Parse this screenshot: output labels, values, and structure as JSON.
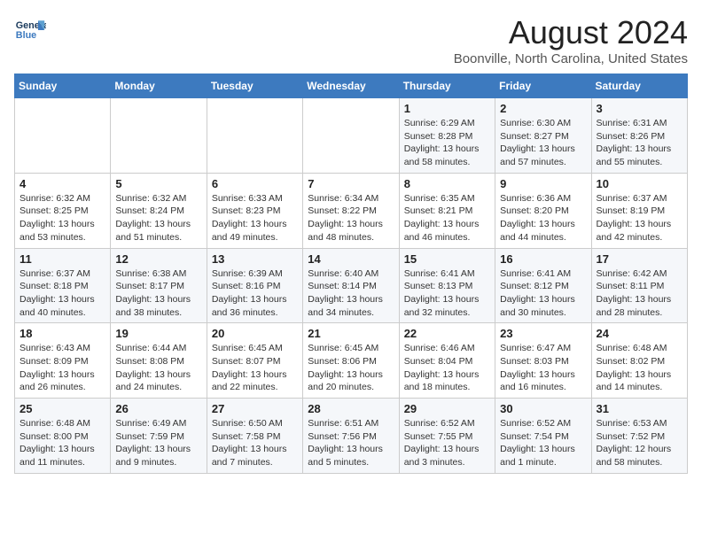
{
  "logo": {
    "line1": "General",
    "line2": "Blue"
  },
  "title": "August 2024",
  "subtitle": "Boonville, North Carolina, United States",
  "days_of_week": [
    "Sunday",
    "Monday",
    "Tuesday",
    "Wednesday",
    "Thursday",
    "Friday",
    "Saturday"
  ],
  "weeks": [
    [
      {
        "day": "",
        "info": ""
      },
      {
        "day": "",
        "info": ""
      },
      {
        "day": "",
        "info": ""
      },
      {
        "day": "",
        "info": ""
      },
      {
        "day": "1",
        "info": "Sunrise: 6:29 AM\nSunset: 8:28 PM\nDaylight: 13 hours\nand 58 minutes."
      },
      {
        "day": "2",
        "info": "Sunrise: 6:30 AM\nSunset: 8:27 PM\nDaylight: 13 hours\nand 57 minutes."
      },
      {
        "day": "3",
        "info": "Sunrise: 6:31 AM\nSunset: 8:26 PM\nDaylight: 13 hours\nand 55 minutes."
      }
    ],
    [
      {
        "day": "4",
        "info": "Sunrise: 6:32 AM\nSunset: 8:25 PM\nDaylight: 13 hours\nand 53 minutes."
      },
      {
        "day": "5",
        "info": "Sunrise: 6:32 AM\nSunset: 8:24 PM\nDaylight: 13 hours\nand 51 minutes."
      },
      {
        "day": "6",
        "info": "Sunrise: 6:33 AM\nSunset: 8:23 PM\nDaylight: 13 hours\nand 49 minutes."
      },
      {
        "day": "7",
        "info": "Sunrise: 6:34 AM\nSunset: 8:22 PM\nDaylight: 13 hours\nand 48 minutes."
      },
      {
        "day": "8",
        "info": "Sunrise: 6:35 AM\nSunset: 8:21 PM\nDaylight: 13 hours\nand 46 minutes."
      },
      {
        "day": "9",
        "info": "Sunrise: 6:36 AM\nSunset: 8:20 PM\nDaylight: 13 hours\nand 44 minutes."
      },
      {
        "day": "10",
        "info": "Sunrise: 6:37 AM\nSunset: 8:19 PM\nDaylight: 13 hours\nand 42 minutes."
      }
    ],
    [
      {
        "day": "11",
        "info": "Sunrise: 6:37 AM\nSunset: 8:18 PM\nDaylight: 13 hours\nand 40 minutes."
      },
      {
        "day": "12",
        "info": "Sunrise: 6:38 AM\nSunset: 8:17 PM\nDaylight: 13 hours\nand 38 minutes."
      },
      {
        "day": "13",
        "info": "Sunrise: 6:39 AM\nSunset: 8:16 PM\nDaylight: 13 hours\nand 36 minutes."
      },
      {
        "day": "14",
        "info": "Sunrise: 6:40 AM\nSunset: 8:14 PM\nDaylight: 13 hours\nand 34 minutes."
      },
      {
        "day": "15",
        "info": "Sunrise: 6:41 AM\nSunset: 8:13 PM\nDaylight: 13 hours\nand 32 minutes."
      },
      {
        "day": "16",
        "info": "Sunrise: 6:41 AM\nSunset: 8:12 PM\nDaylight: 13 hours\nand 30 minutes."
      },
      {
        "day": "17",
        "info": "Sunrise: 6:42 AM\nSunset: 8:11 PM\nDaylight: 13 hours\nand 28 minutes."
      }
    ],
    [
      {
        "day": "18",
        "info": "Sunrise: 6:43 AM\nSunset: 8:09 PM\nDaylight: 13 hours\nand 26 minutes."
      },
      {
        "day": "19",
        "info": "Sunrise: 6:44 AM\nSunset: 8:08 PM\nDaylight: 13 hours\nand 24 minutes."
      },
      {
        "day": "20",
        "info": "Sunrise: 6:45 AM\nSunset: 8:07 PM\nDaylight: 13 hours\nand 22 minutes."
      },
      {
        "day": "21",
        "info": "Sunrise: 6:45 AM\nSunset: 8:06 PM\nDaylight: 13 hours\nand 20 minutes."
      },
      {
        "day": "22",
        "info": "Sunrise: 6:46 AM\nSunset: 8:04 PM\nDaylight: 13 hours\nand 18 minutes."
      },
      {
        "day": "23",
        "info": "Sunrise: 6:47 AM\nSunset: 8:03 PM\nDaylight: 13 hours\nand 16 minutes."
      },
      {
        "day": "24",
        "info": "Sunrise: 6:48 AM\nSunset: 8:02 PM\nDaylight: 13 hours\nand 14 minutes."
      }
    ],
    [
      {
        "day": "25",
        "info": "Sunrise: 6:48 AM\nSunset: 8:00 PM\nDaylight: 13 hours\nand 11 minutes."
      },
      {
        "day": "26",
        "info": "Sunrise: 6:49 AM\nSunset: 7:59 PM\nDaylight: 13 hours\nand 9 minutes."
      },
      {
        "day": "27",
        "info": "Sunrise: 6:50 AM\nSunset: 7:58 PM\nDaylight: 13 hours\nand 7 minutes."
      },
      {
        "day": "28",
        "info": "Sunrise: 6:51 AM\nSunset: 7:56 PM\nDaylight: 13 hours\nand 5 minutes."
      },
      {
        "day": "29",
        "info": "Sunrise: 6:52 AM\nSunset: 7:55 PM\nDaylight: 13 hours\nand 3 minutes."
      },
      {
        "day": "30",
        "info": "Sunrise: 6:52 AM\nSunset: 7:54 PM\nDaylight: 13 hours\nand 1 minute."
      },
      {
        "day": "31",
        "info": "Sunrise: 6:53 AM\nSunset: 7:52 PM\nDaylight: 12 hours\nand 58 minutes."
      }
    ]
  ]
}
